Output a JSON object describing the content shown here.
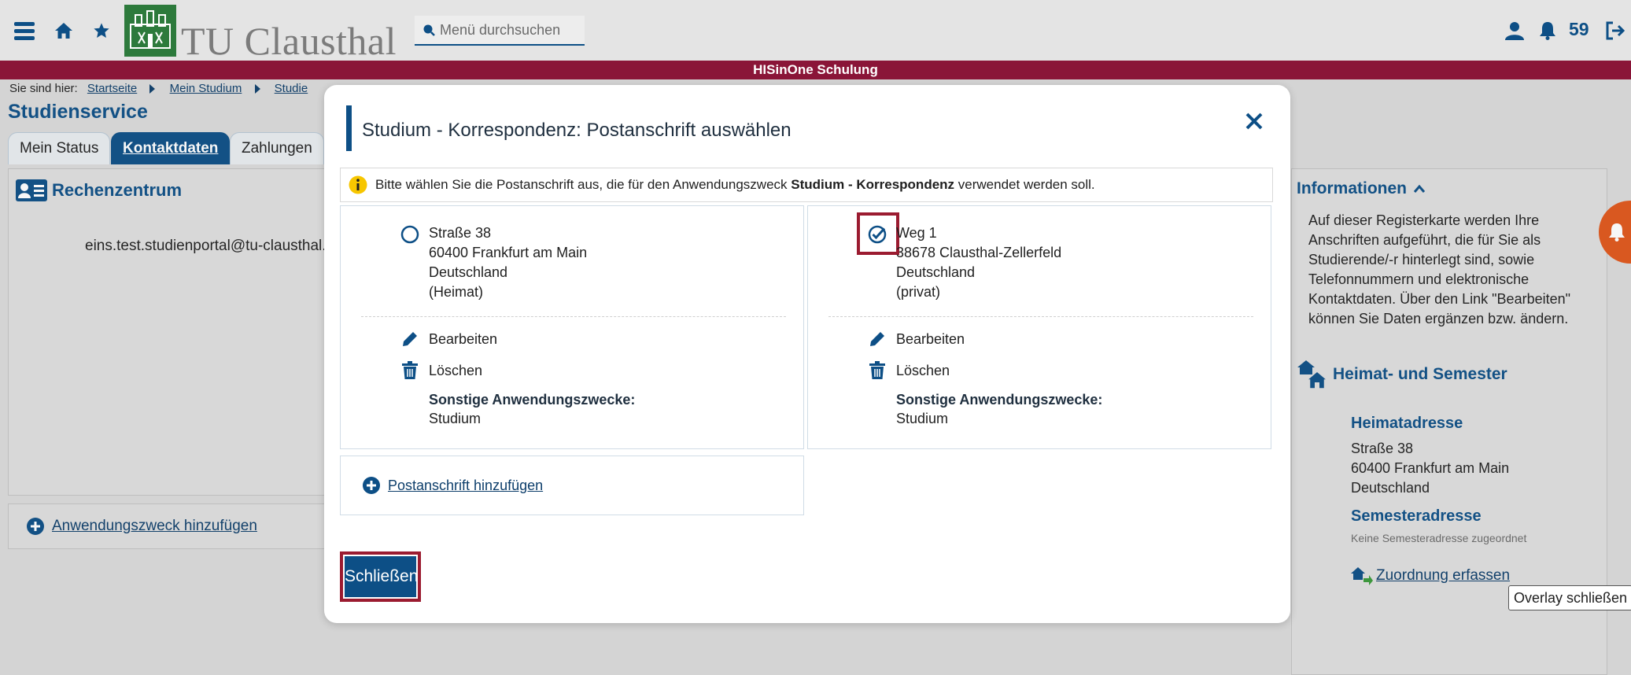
{
  "header": {
    "logo_text": "TU Clausthal",
    "search_placeholder": "Menü durchsuchen",
    "notification_count": "59",
    "banner": "HISinOne Schulung"
  },
  "breadcrumb": {
    "prefix": "Sie sind hier:",
    "items": [
      "Startseite",
      "Mein Studium",
      "Studie"
    ]
  },
  "page": {
    "title": "Studienservice",
    "tabs": [
      "Mein Status",
      "Kontaktdaten",
      "Zahlungen"
    ],
    "rz_title": "Rechenzentrum",
    "email": "eins.test.studienportal@tu-clausthal.de",
    "add_zweck": "Anwendungszweck hinzufügen"
  },
  "info": {
    "title": "Informationen",
    "text": "Auf dieser Registerkarte werden Ihre Anschriften aufgeführt, die für Sie als Studierende/-r hinterlegt sind, sowie Telefonnummern und elektronische Kontaktdaten. Über den Link \"Bearbeiten\" können Sie Daten ergänzen bzw. ändern.",
    "hs_title": "Heimat- und Semester",
    "heimat_label": "Heimatadresse",
    "heimat_street": "Straße 38",
    "heimat_city": "60400 Frankfurt am Main",
    "heimat_country": "Deutschland",
    "semester_label": "Semesteradresse",
    "semester_none": "Keine Semesteradresse zugeordnet",
    "zuordnung": "Zuordnung erfassen",
    "tooltip": "Overlay schließen"
  },
  "modal": {
    "title": "Studium - Korrespondenz: Postanschrift auswählen",
    "notice_pre": "Bitte wählen Sie die Postanschrift aus, die für den Anwendungszweck",
    "notice_bold": "Studium - Korrespondenz",
    "notice_post": "verwendet werden soll.",
    "addresses": [
      {
        "street": "Straße 38",
        "city": "60400 Frankfurt am Main",
        "country": "Deutschland",
        "type": "(Heimat)",
        "selected": false
      },
      {
        "street": "Weg 1",
        "city": "38678 Clausthal-Zellerfeld",
        "country": "Deutschland",
        "type": "(privat)",
        "selected": true
      }
    ],
    "edit_label": "Bearbeiten",
    "delete_label": "Löschen",
    "other_purposes_label": "Sonstige Anwendungszwecke:",
    "other_purposes_value": "Studium",
    "add_address": "Postanschrift hinzufügen",
    "close_button": "Schließen"
  },
  "colors": {
    "primary": "#0d4f86",
    "banner": "#8a1538",
    "highlight": "#9b1b30",
    "logo_green": "#2d7a3c",
    "fab": "#e0571b"
  }
}
